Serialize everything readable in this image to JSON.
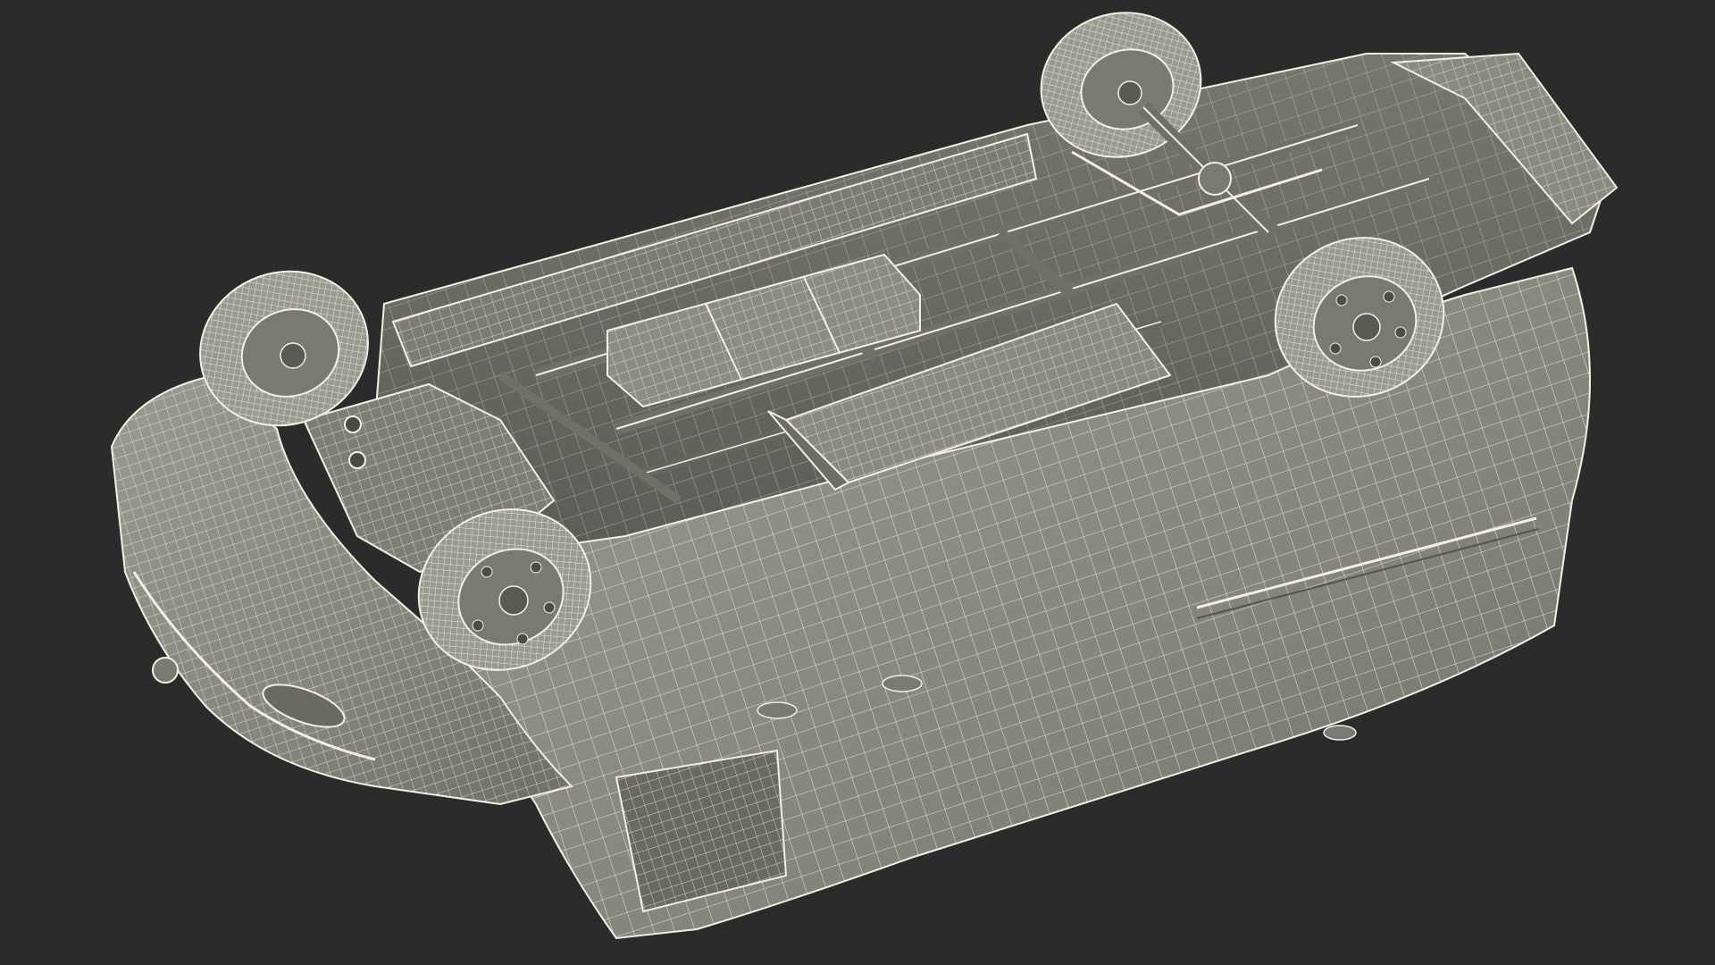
{
  "scene": {
    "subject": "van-wireframe-render",
    "colors": {
      "background": "#2b2b2b",
      "body_fill": "#8a8a80",
      "body_shade": "#6e6e66",
      "body_dark": "#55554f",
      "wire": "#f2f0e4",
      "wire_dim": "#d8d6c8"
    }
  }
}
